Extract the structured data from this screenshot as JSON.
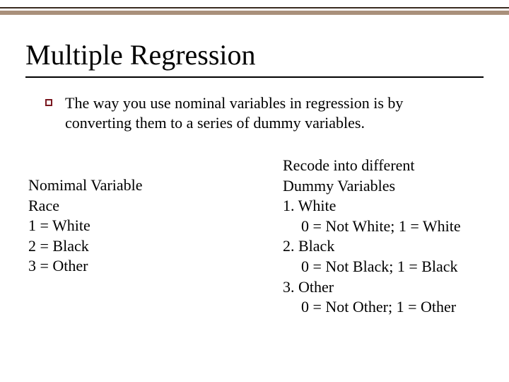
{
  "title": "Multiple Regression",
  "bullet": "The way you use nominal variables in regression is by converting them to a series of dummy variables.",
  "left": {
    "heading": "Nomimal Variable",
    "label": "Race",
    "items": [
      "1 = White",
      "2 = Black",
      "3 = Other"
    ]
  },
  "right": {
    "heading_l1": "Recode into different",
    "heading_l2": "Dummy Variables",
    "items": [
      {
        "num": "1. White",
        "detail": "0 = Not White; 1 = White"
      },
      {
        "num": "2. Black",
        "detail": "0 = Not Black; 1 = Black"
      },
      {
        "num": "3. Other",
        "detail": "0 = Not Other; 1 = Other"
      }
    ]
  }
}
